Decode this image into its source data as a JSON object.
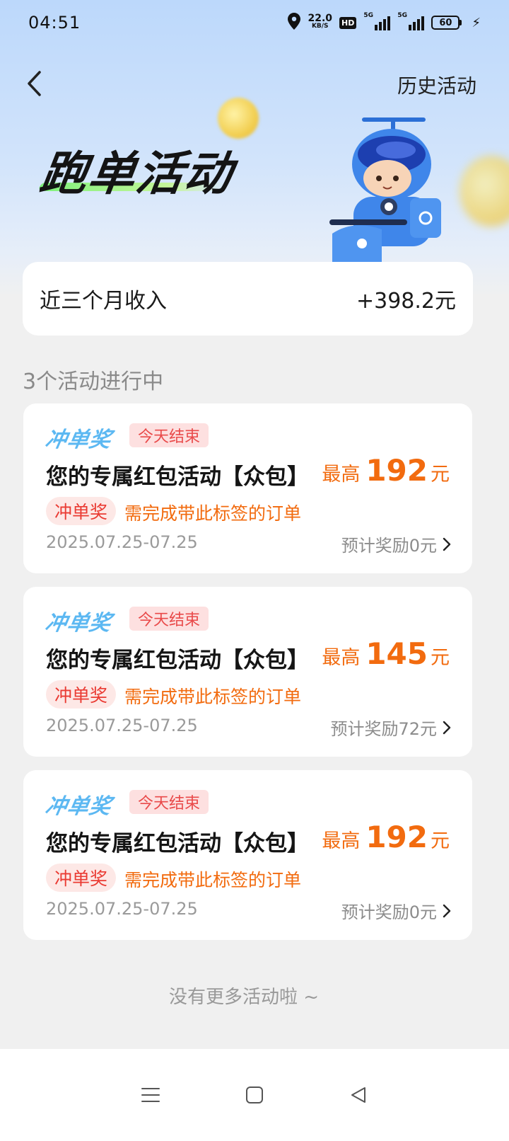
{
  "status_bar": {
    "time": "04:51",
    "net_speed_value": "22.0",
    "net_speed_unit": "KB/S",
    "hd": "HD",
    "signal1_label": "5G",
    "signal2_label": "5G",
    "battery": "60",
    "icons": [
      "location-icon",
      "hd-icon",
      "signal-icon",
      "battery-icon",
      "charging-icon"
    ]
  },
  "nav": {
    "back_icon": "chevron-left-icon",
    "history_label": "历史活动"
  },
  "hero": {
    "title": "跑单活动"
  },
  "income": {
    "label": "近三个月收入",
    "value": "+398.2元"
  },
  "section": {
    "title": "3个活动进行中"
  },
  "activities": [
    {
      "promo_logo": "冲单奖",
      "end_badge": "今天结束",
      "title": "您的专属红包活动【众包】",
      "max_prefix": "最高",
      "max_value": "192",
      "max_unit": "元",
      "tag": "冲单奖",
      "requirement": "需完成带此标签的订单",
      "date": "2025.07.25-07.25",
      "reward": "预计奖励0元"
    },
    {
      "promo_logo": "冲单奖",
      "end_badge": "今天结束",
      "title": "您的专属红包活动【众包】",
      "max_prefix": "最高",
      "max_value": "145",
      "max_unit": "元",
      "tag": "冲单奖",
      "requirement": "需完成带此标签的订单",
      "date": "2025.07.25-07.25",
      "reward": "预计奖励72元"
    },
    {
      "promo_logo": "冲单奖",
      "end_badge": "今天结束",
      "title": "您的专属红包活动【众包】",
      "max_prefix": "最高",
      "max_value": "192",
      "max_unit": "元",
      "tag": "冲单奖",
      "requirement": "需完成带此标签的订单",
      "date": "2025.07.25-07.25",
      "reward": "预计奖励0元"
    }
  ],
  "footer": {
    "no_more": "没有更多活动啦 ~"
  },
  "system_nav": {
    "icons": [
      "menu-icon",
      "home-square-icon",
      "back-triangle-icon"
    ]
  },
  "colors": {
    "accent_orange": "#f26b0f",
    "tag_red": "#ea3b33",
    "promo_blue": "#5cb8f2",
    "hero_blue": "#bcd8fb"
  }
}
